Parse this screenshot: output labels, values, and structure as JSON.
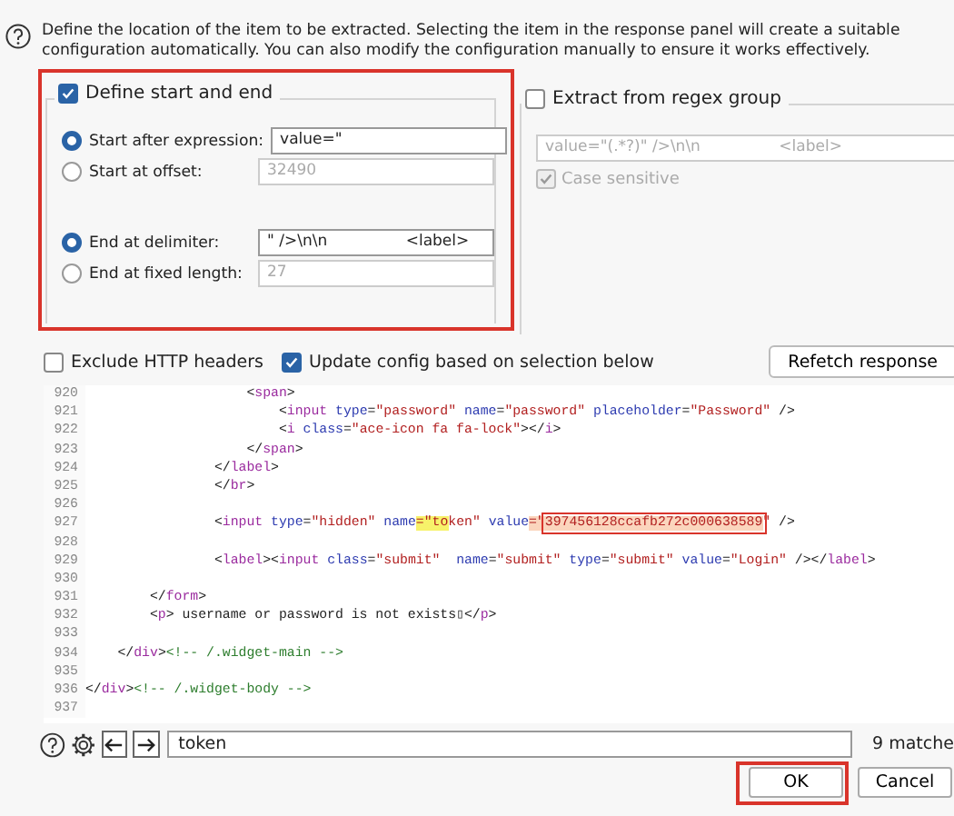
{
  "description": "Define the location of the item to be extracted. Selecting the item in the response panel will create a suitable configuration automatically. You can also modify the configuration manually to ensure it works effectively.",
  "start_end": {
    "label": "Define start and end",
    "checked": true,
    "start_options": [
      {
        "label": "Start after expression:",
        "selected": true,
        "value": "value=\"",
        "disabled": false
      },
      {
        "label": "Start at offset:",
        "selected": false,
        "value": "32490",
        "disabled": true
      }
    ],
    "end_options": [
      {
        "label": "End at delimiter:",
        "selected": true,
        "value": "\" />\\n\\n                <label>",
        "disabled": false
      },
      {
        "label": "End at fixed length:",
        "selected": false,
        "value": "27",
        "disabled": true
      }
    ]
  },
  "regex_group": {
    "label": "Extract from regex group",
    "checked": false,
    "value": "value=\"(.*?)\" />\\n\\n                <label>",
    "case_sensitive": {
      "label": "Case sensitive",
      "checked": true
    }
  },
  "options": [
    {
      "label": "Exclude HTTP headers",
      "checked": false
    },
    {
      "label": "Update config based on selection below",
      "checked": true
    }
  ],
  "refetch_button": "Refetch response",
  "code_lines": [
    {
      "number": "920",
      "tokens": [
        {
          "kind": "punct",
          "text": "                    <"
        },
        {
          "kind": "tag",
          "text": "span"
        },
        {
          "kind": "punct",
          "text": ">"
        }
      ]
    },
    {
      "number": "921",
      "tokens": [
        {
          "kind": "punct",
          "text": "                        <"
        },
        {
          "kind": "tag",
          "text": "input"
        },
        {
          "kind": "attr",
          "text": " type"
        },
        {
          "kind": "punct",
          "text": "="
        },
        {
          "kind": "str",
          "text": "\"password\""
        },
        {
          "kind": "attr",
          "text": " name"
        },
        {
          "kind": "punct",
          "text": "="
        },
        {
          "kind": "str",
          "text": "\"password\""
        },
        {
          "kind": "attr",
          "text": " placeholder"
        },
        {
          "kind": "punct",
          "text": "="
        },
        {
          "kind": "str",
          "text": "\"Password\""
        },
        {
          "kind": "punct",
          "text": " />"
        }
      ]
    },
    {
      "number": "922",
      "tokens": [
        {
          "kind": "punct",
          "text": "                        <"
        },
        {
          "kind": "tag",
          "text": "i"
        },
        {
          "kind": "attr",
          "text": " class"
        },
        {
          "kind": "punct",
          "text": "="
        },
        {
          "kind": "str",
          "text": "\"ace-icon fa fa-lock\""
        },
        {
          "kind": "punct",
          "text": "></"
        },
        {
          "kind": "tag",
          "text": "i"
        },
        {
          "kind": "punct",
          "text": ">"
        }
      ]
    },
    {
      "number": "923",
      "tokens": [
        {
          "kind": "punct",
          "text": "                    </"
        },
        {
          "kind": "tag",
          "text": "span"
        },
        {
          "kind": "punct",
          "text": ">"
        }
      ]
    },
    {
      "number": "924",
      "tokens": [
        {
          "kind": "punct",
          "text": "                </"
        },
        {
          "kind": "tag",
          "text": "label"
        },
        {
          "kind": "punct",
          "text": ">"
        }
      ]
    },
    {
      "number": "925",
      "tokens": [
        {
          "kind": "punct",
          "text": "                </"
        },
        {
          "kind": "tag",
          "text": "br"
        },
        {
          "kind": "punct",
          "text": ">"
        }
      ]
    },
    {
      "number": "926"
    },
    {
      "number": "927",
      "tokens": [
        {
          "kind": "punct",
          "text": "                <"
        },
        {
          "kind": "tag",
          "text": "input"
        },
        {
          "kind": "attr",
          "text": " type"
        },
        {
          "kind": "punct",
          "text": "="
        },
        {
          "kind": "str",
          "text": "\"hidden\""
        },
        {
          "kind": "attr",
          "text": " name"
        },
        {
          "kind": "match",
          "text": "=\"to"
        },
        {
          "kind": "str",
          "text": "ken\""
        },
        {
          "kind": "attr",
          "text": " value"
        },
        {
          "kind": "selection",
          "text": "=\""
        },
        {
          "kind": "boxed",
          "text": "397456128ccafb272c000638589"
        },
        {
          "kind": "str",
          "text": "\""
        },
        {
          "kind": "punct",
          "text": " />"
        }
      ]
    },
    {
      "number": "928"
    },
    {
      "number": "929",
      "tokens": [
        {
          "kind": "punct",
          "text": "                <"
        },
        {
          "kind": "tag",
          "text": "label"
        },
        {
          "kind": "punct",
          "text": "><"
        },
        {
          "kind": "tag",
          "text": "input"
        },
        {
          "kind": "attr",
          "text": " class"
        },
        {
          "kind": "punct",
          "text": "="
        },
        {
          "kind": "str",
          "text": "\"submit\""
        },
        {
          "kind": "attr",
          "text": "  name"
        },
        {
          "kind": "punct",
          "text": "="
        },
        {
          "kind": "str",
          "text": "\"submit\""
        },
        {
          "kind": "attr",
          "text": " type"
        },
        {
          "kind": "punct",
          "text": "="
        },
        {
          "kind": "str",
          "text": "\"submit\""
        },
        {
          "kind": "attr",
          "text": " value"
        },
        {
          "kind": "punct",
          "text": "="
        },
        {
          "kind": "str",
          "text": "\"Login\""
        },
        {
          "kind": "punct",
          "text": " /></"
        },
        {
          "kind": "tag",
          "text": "label"
        },
        {
          "kind": "punct",
          "text": ">"
        }
      ]
    },
    {
      "number": "930"
    },
    {
      "number": "931",
      "tokens": [
        {
          "kind": "punct",
          "text": "        </"
        },
        {
          "kind": "tag",
          "text": "form"
        },
        {
          "kind": "punct",
          "text": ">"
        }
      ]
    },
    {
      "number": "932",
      "tokens": [
        {
          "kind": "punct",
          "text": "        <"
        },
        {
          "kind": "tag",
          "text": "p"
        },
        {
          "kind": "punct",
          "text": "> username or password is not exists▯</"
        },
        {
          "kind": "tag",
          "text": "p"
        },
        {
          "kind": "punct",
          "text": ">"
        }
      ]
    },
    {
      "number": "933"
    },
    {
      "number": "934",
      "tokens": [
        {
          "kind": "punct",
          "text": "    </"
        },
        {
          "kind": "tag",
          "text": "div"
        },
        {
          "kind": "punct",
          "text": ">"
        },
        {
          "kind": "comment",
          "text": "<!-- /.widget-main -->"
        }
      ]
    },
    {
      "number": "935"
    },
    {
      "number": "936",
      "tokens": [
        {
          "kind": "punct",
          "text": "</"
        },
        {
          "kind": "tag",
          "text": "div"
        },
        {
          "kind": "punct",
          "text": ">"
        },
        {
          "kind": "comment",
          "text": "<!-- /.widget-body -->"
        }
      ]
    },
    {
      "number": "937"
    }
  ],
  "search": {
    "value": "token",
    "matches": "9 matche"
  },
  "buttons": [
    "OK",
    "Cancel"
  ]
}
